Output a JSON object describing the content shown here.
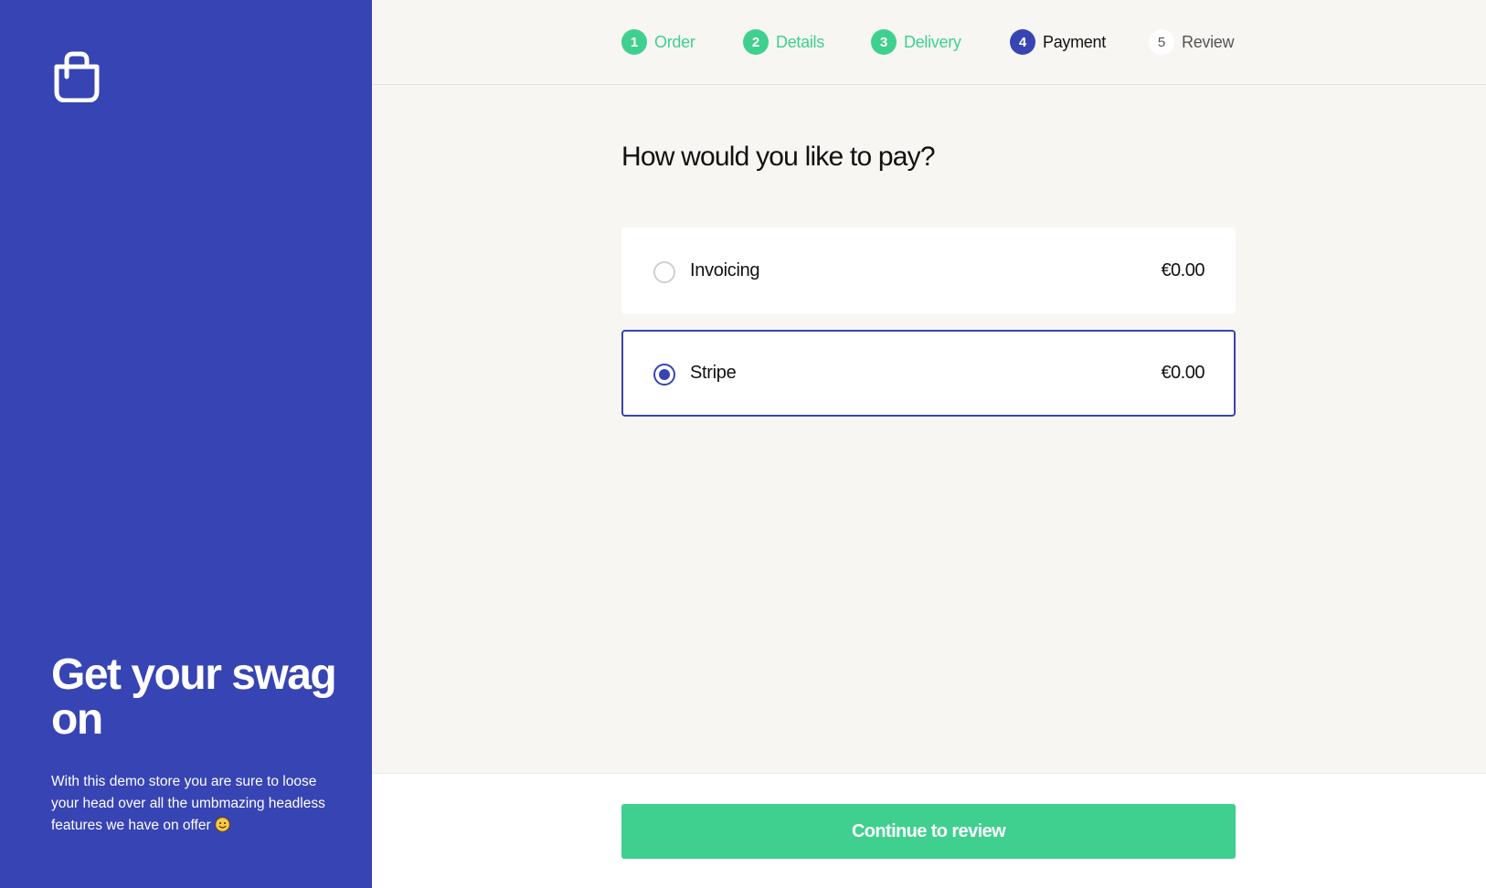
{
  "colors": {
    "sidebar_bg": "#3744b3",
    "accent_green": "#3fd08f",
    "accent_blue": "#3744b3",
    "page_bg": "#f7f6f3"
  },
  "sidebar": {
    "logo_icon": "shopping-bag-icon",
    "title": "Get your swag on",
    "description": "With this demo store you are sure to loose your head over all the umbmazing headless features we have on offer",
    "emoji_icon": "smiley-icon"
  },
  "steps": [
    {
      "number": "1",
      "label": "Order",
      "state": "done"
    },
    {
      "number": "2",
      "label": "Details",
      "state": "done"
    },
    {
      "number": "3",
      "label": "Delivery",
      "state": "done"
    },
    {
      "number": "4",
      "label": "Payment",
      "state": "active"
    },
    {
      "number": "5",
      "label": "Review",
      "state": "pending"
    }
  ],
  "payment": {
    "heading": "How would you like to pay?",
    "options": [
      {
        "label": "Invoicing",
        "price": "€0.00",
        "selected": false
      },
      {
        "label": "Stripe",
        "price": "€0.00",
        "selected": true
      }
    ]
  },
  "footer": {
    "continue_label": "Continue to review"
  }
}
